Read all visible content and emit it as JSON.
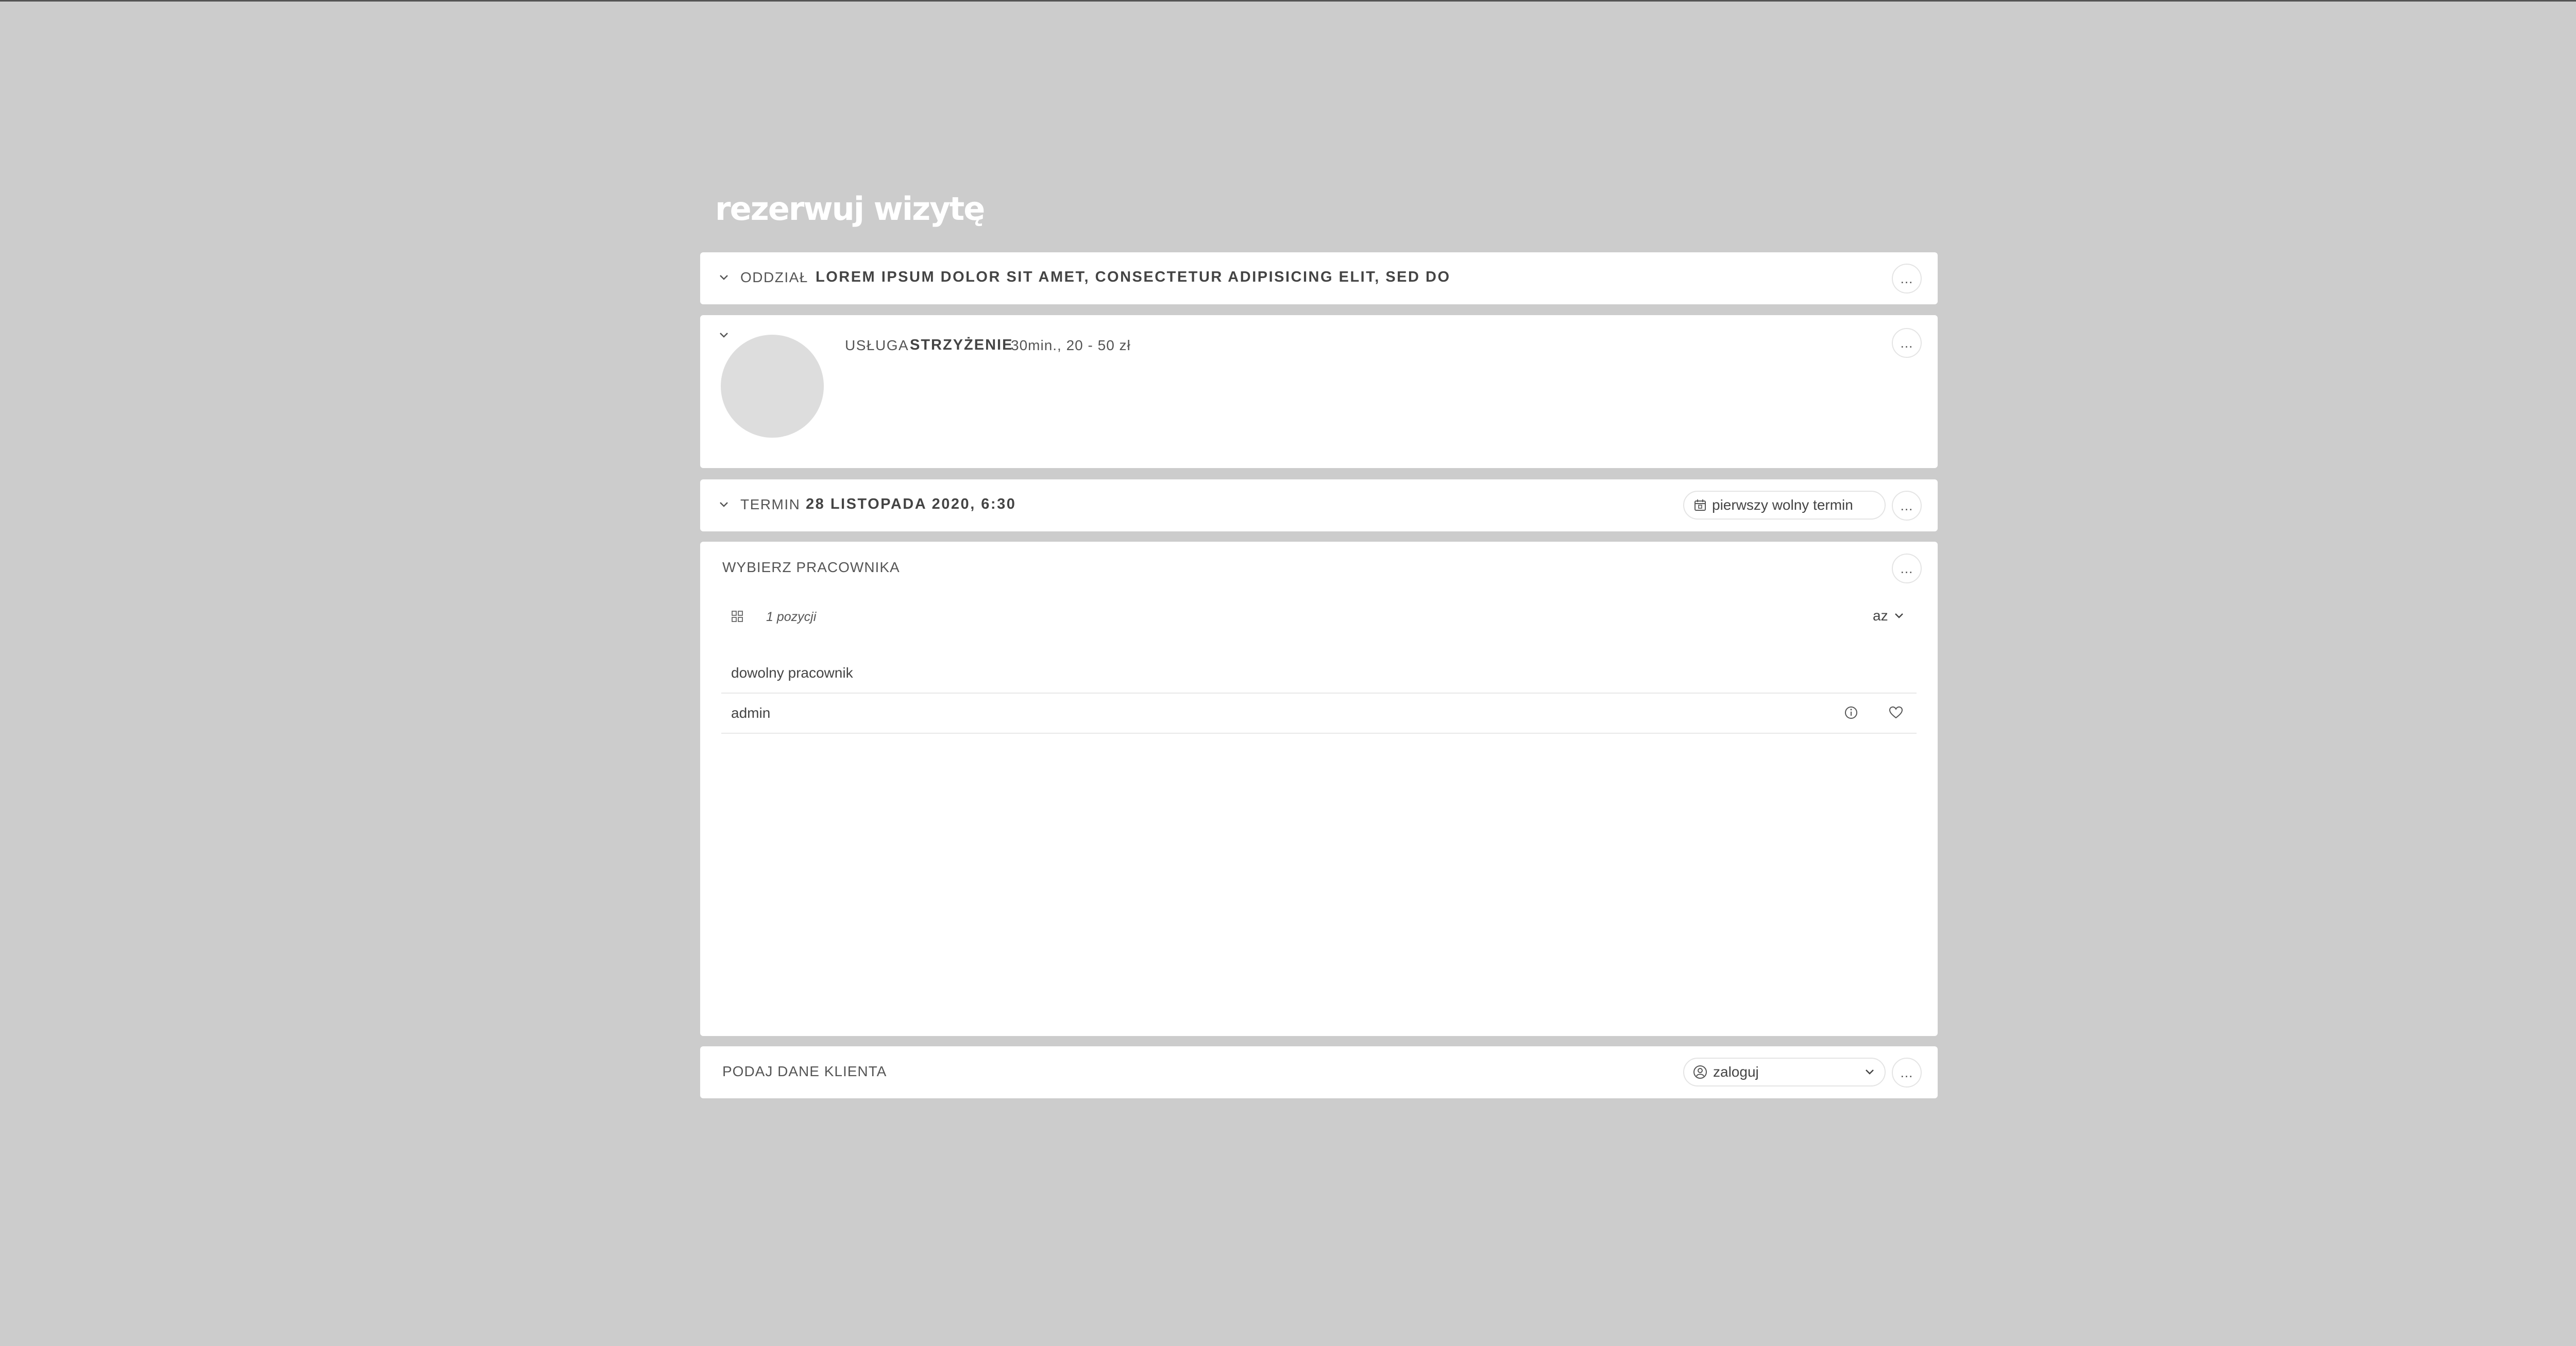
{
  "page": {
    "title": "rezerwuj wizytę"
  },
  "branch": {
    "label": "ODDZIAŁ",
    "value": "LOREM IPSUM DOLOR SIT AMET, CONSECTETUR ADIPISICING ELIT, SED DO",
    "more": "..."
  },
  "service": {
    "label": "USŁUGA",
    "name": "STRZYŻENIE",
    "details": "30min., 20 - 50 zł",
    "more": "..."
  },
  "term": {
    "label": "TERMIN",
    "value": "28 LISTOPADA 2020, 6:30",
    "first_free_label": "pierwszy wolny termin",
    "more": "..."
  },
  "employee": {
    "header": "WYBIERZ PRACOWNIKA",
    "more": "...",
    "count_label": "1 pozycji",
    "sort_label": "az",
    "items": [
      {
        "label": "dowolny pracownik"
      },
      {
        "label": "admin"
      }
    ]
  },
  "client": {
    "header": "PODAJ DANE KLIENTA",
    "login_label": "zaloguj",
    "more": "..."
  }
}
